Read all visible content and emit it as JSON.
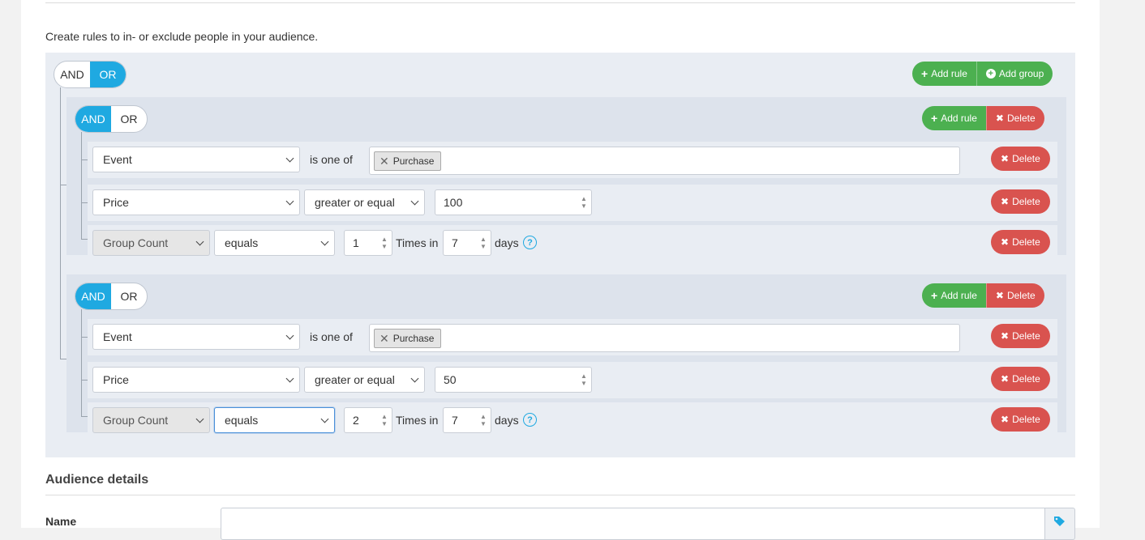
{
  "intro_text": "Create rules to in- or exclude people in your audience.",
  "root": {
    "and_label": "AND",
    "or_label": "OR",
    "active": "OR",
    "add_rule_label": "Add rule",
    "add_group_label": "Add group"
  },
  "groups": [
    {
      "and_label": "AND",
      "or_label": "OR",
      "active": "AND",
      "add_rule_label": "Add rule",
      "delete_label": "Delete",
      "rules": [
        {
          "field": "Event",
          "operator": "is one of",
          "tag": "Purchase",
          "delete_label": "Delete"
        },
        {
          "field": "Price",
          "operator": "greater or equal",
          "value": "100",
          "delete_label": "Delete"
        },
        {
          "field": "Group Count",
          "operator": "equals",
          "count": "1",
          "times_label": "Times in",
          "days_value": "7",
          "days_label": "days",
          "delete_label": "Delete"
        }
      ]
    },
    {
      "and_label": "AND",
      "or_label": "OR",
      "active": "AND",
      "add_rule_label": "Add rule",
      "delete_label": "Delete",
      "rules": [
        {
          "field": "Event",
          "operator": "is one of",
          "tag": "Purchase",
          "delete_label": "Delete"
        },
        {
          "field": "Price",
          "operator": "greater or equal",
          "value": "50",
          "delete_label": "Delete"
        },
        {
          "field": "Group Count",
          "operator": "equals",
          "count": "2",
          "times_label": "Times in",
          "days_value": "7",
          "days_label": "days",
          "delete_label": "Delete"
        }
      ]
    }
  ],
  "details": {
    "title": "Audience details",
    "name_label": "Name",
    "name_value": ""
  },
  "colors": {
    "primary": "#1fa9e1",
    "add": "#4cb050",
    "delete": "#d9534f"
  },
  "icons": {
    "plus": "plus-icon",
    "plus_circle": "plus-circle-icon",
    "times": "times-icon",
    "help": "question-circle-icon",
    "tag": "tags-icon"
  }
}
